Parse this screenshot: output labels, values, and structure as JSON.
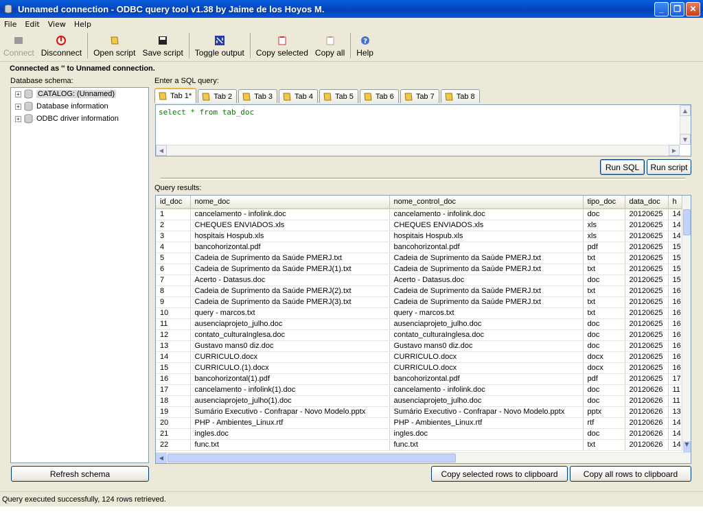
{
  "window": {
    "title": "Unnamed connection - ODBC query tool v1.38 by Jaime de los Hoyos M."
  },
  "menu": [
    "File",
    "Edit",
    "View",
    "Help"
  ],
  "toolbar": {
    "connect": "Connect",
    "disconnect": "Disconnect",
    "open_script": "Open script",
    "save_script": "Save script",
    "toggle_output": "Toggle output",
    "copy_selected": "Copy selected",
    "copy_all": "Copy all",
    "help": "Help"
  },
  "status_connected": "Connected as '' to Unnamed connection.",
  "schema": {
    "label": "Database schema:",
    "items": [
      "CATALOG: (Unnamed)",
      "Database information",
      "ODBC driver information"
    ],
    "refresh": "Refresh schema"
  },
  "query": {
    "label": "Enter a SQL query:",
    "tabs": [
      "Tab 1*",
      "Tab 2",
      "Tab 3",
      "Tab 4",
      "Tab 5",
      "Tab 6",
      "Tab 7",
      "Tab 8"
    ],
    "sql": "select * from tab_doc",
    "run_sql": "Run SQL",
    "run_script": "Run script"
  },
  "results": {
    "label": "Query results:",
    "columns": [
      "id_doc",
      "nome_doc",
      "nome_control_doc",
      "tipo_doc",
      "data_doc",
      "h"
    ],
    "rows": [
      [
        "1",
        "cancelamento - infolink.doc",
        "cancelamento - infolink.doc",
        "doc",
        "20120625",
        "14"
      ],
      [
        "2",
        "CHEQUES ENVIADOS.xls",
        "CHEQUES ENVIADOS.xls",
        "xls",
        "20120625",
        "14"
      ],
      [
        "3",
        "hospitais Hospub.xls",
        "hospitais Hospub.xls",
        "xls",
        "20120625",
        "14"
      ],
      [
        "4",
        "bancohorizontal.pdf",
        "bancohorizontal.pdf",
        "pdf",
        "20120625",
        "15"
      ],
      [
        "5",
        "Cadeia de Suprimento da Saúde PMERJ.txt",
        "Cadeia de Suprimento da Saúde PMERJ.txt",
        "txt",
        "20120625",
        "15"
      ],
      [
        "6",
        "Cadeia de Suprimento da Saúde PMERJ(1).txt",
        "Cadeia de Suprimento da Saúde PMERJ.txt",
        "txt",
        "20120625",
        "15"
      ],
      [
        "7",
        "Acerto - Datasus.doc",
        "Acerto - Datasus.doc",
        "doc",
        "20120625",
        "15"
      ],
      [
        "8",
        "Cadeia de Suprimento da Saúde PMERJ(2).txt",
        "Cadeia de Suprimento da Saúde PMERJ.txt",
        "txt",
        "20120625",
        "16"
      ],
      [
        "9",
        "Cadeia de Suprimento da Saúde PMERJ(3).txt",
        "Cadeia de Suprimento da Saúde PMERJ.txt",
        "txt",
        "20120625",
        "16"
      ],
      [
        "10",
        "query - marcos.txt",
        "query - marcos.txt",
        "txt",
        "20120625",
        "16"
      ],
      [
        "11",
        "ausenciaprojeto_julho.doc",
        "ausenciaprojeto_julho.doc",
        "doc",
        "20120625",
        "16"
      ],
      [
        "12",
        "contato_culturaInglesa.doc",
        "contato_culturaInglesa.doc",
        "doc",
        "20120625",
        "16"
      ],
      [
        "13",
        "Gustavo mans0 diz.doc",
        "Gustavo mans0 diz.doc",
        "doc",
        "20120625",
        "16"
      ],
      [
        "14",
        "CURRICULO.docx",
        "CURRICULO.docx",
        "docx",
        "20120625",
        "16"
      ],
      [
        "15",
        "CURRICULO.(1).docx",
        "CURRICULO.docx",
        "docx",
        "20120625",
        "16"
      ],
      [
        "16",
        "bancohorizontal(1).pdf",
        "bancohorizontal.pdf",
        "pdf",
        "20120625",
        "17"
      ],
      [
        "17",
        "cancelamento - infolink(1).doc",
        "cancelamento - infolink.doc",
        "doc",
        "20120626",
        "11"
      ],
      [
        "18",
        "ausenciaprojeto_julho(1).doc",
        "ausenciaprojeto_julho.doc",
        "doc",
        "20120626",
        "11"
      ],
      [
        "19",
        "Sumário Executivo - Confrapar - Novo Modelo.pptx",
        "Sumário Executivo - Confrapar - Novo Modelo.pptx",
        "pptx",
        "20120626",
        "13"
      ],
      [
        "20",
        "PHP - Ambientes_Linux.rtf",
        "PHP - Ambientes_Linux.rtf",
        "rtf",
        "20120626",
        "14"
      ],
      [
        "21",
        "ingles.doc",
        "ingles.doc",
        "doc",
        "20120626",
        "14"
      ],
      [
        "22",
        "func.txt",
        "func.txt",
        "txt",
        "20120626",
        "14"
      ]
    ],
    "copy_selected_rows": "Copy selected rows to clipboard",
    "copy_all_rows": "Copy all rows to clipboard"
  },
  "status_bar": "Query executed successfully, 124 rows retrieved.",
  "icons": {
    "app": "database-icon",
    "connect": "connect-icon",
    "disconnect": "power-icon",
    "open": "scroll-icon",
    "save": "floppy-disk-icon",
    "toggle": "toggle-output-icon",
    "copy": "clipboard-icon",
    "help": "help-icon"
  },
  "colors": {
    "titlebar": "#0a55d6",
    "sql_text": "#008000",
    "chrome": "#ece9d8",
    "tab_accent": "#f5b13a"
  }
}
